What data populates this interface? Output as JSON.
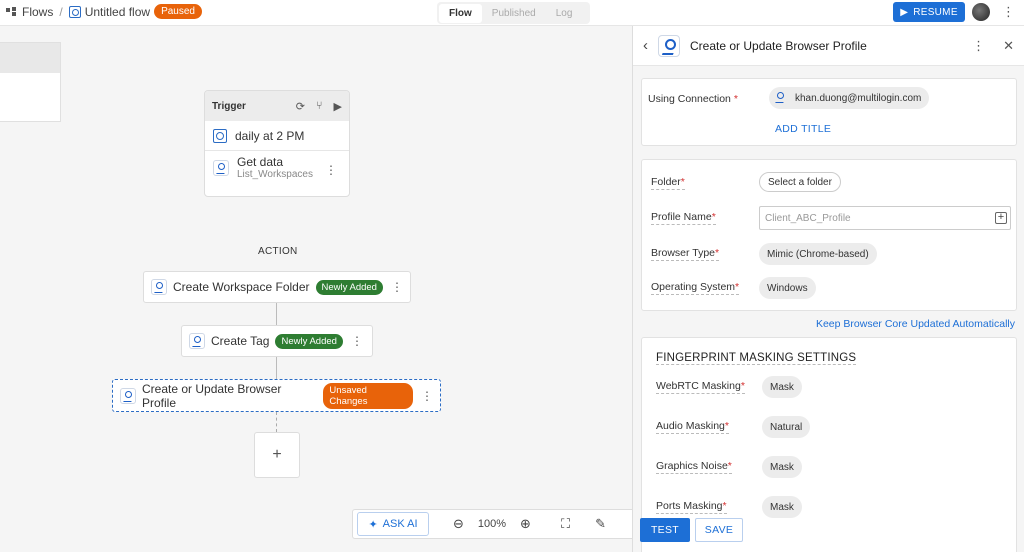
{
  "header": {
    "flows_label": "Flows",
    "separator": "/",
    "flow_title": "Untitled flow",
    "status_badge": "Paused",
    "tabs": [
      {
        "label": "Flow",
        "active": true
      },
      {
        "label": "Published",
        "active": false
      },
      {
        "label": "Log",
        "active": false
      }
    ],
    "resume_label": "RESUME",
    "more_icon": "more-vertical-icon"
  },
  "canvas": {
    "trigger": {
      "title": "Trigger",
      "schedule": "daily at 2 PM",
      "step_title": "Get data",
      "step_sub": "List_Workspaces",
      "icons": [
        "refresh-icon",
        "branch-icon",
        "play-icon"
      ]
    },
    "action_label": "ACTION",
    "actions": [
      {
        "label": "Create Workspace Folder",
        "badge": "Newly Added",
        "badge_color": "#2e7d32"
      },
      {
        "label": "Create Tag",
        "badge": "Newly Added",
        "badge_color": "#2e7d32"
      },
      {
        "label": "Create or Update Browser Profile",
        "badge": "Unsaved Changes",
        "badge_color": "#e8630a"
      }
    ],
    "add_step": "+",
    "toolbar": {
      "ask_ai": "ASK AI",
      "zoom": "100%"
    }
  },
  "panel": {
    "title": "Create or Update Browser Profile",
    "connection": {
      "label": "Using Connection",
      "value": "khan.duong@multilogin.com",
      "add_title": "ADD TITLE"
    },
    "fields": {
      "folder_label": "Folder",
      "folder_value": "Select a folder",
      "profile_name_label": "Profile Name",
      "profile_name_placeholder": "Client_ABC_Profile",
      "browser_type_label": "Browser Type",
      "browser_type_value": "Mimic (Chrome-based)",
      "os_label": "Operating System",
      "os_value": "Windows"
    },
    "keep_updated": "Keep Browser Core Updated Automatically",
    "fingerprint": {
      "title": "FINGERPRINT MASKING SETTINGS",
      "rows": [
        {
          "label": "WebRTC Masking",
          "value": "Mask"
        },
        {
          "label": "Audio Masking",
          "value": "Natural"
        },
        {
          "label": "Graphics Noise",
          "value": "Mask"
        },
        {
          "label": "Ports Masking",
          "value": "Mask"
        }
      ]
    },
    "test_label": "TEST",
    "save_label": "SAVE"
  },
  "colors": {
    "accent": "#1d6fd6",
    "paused": "#e8630a",
    "newly_added": "#2e7d32",
    "unsaved": "#e8630a"
  }
}
